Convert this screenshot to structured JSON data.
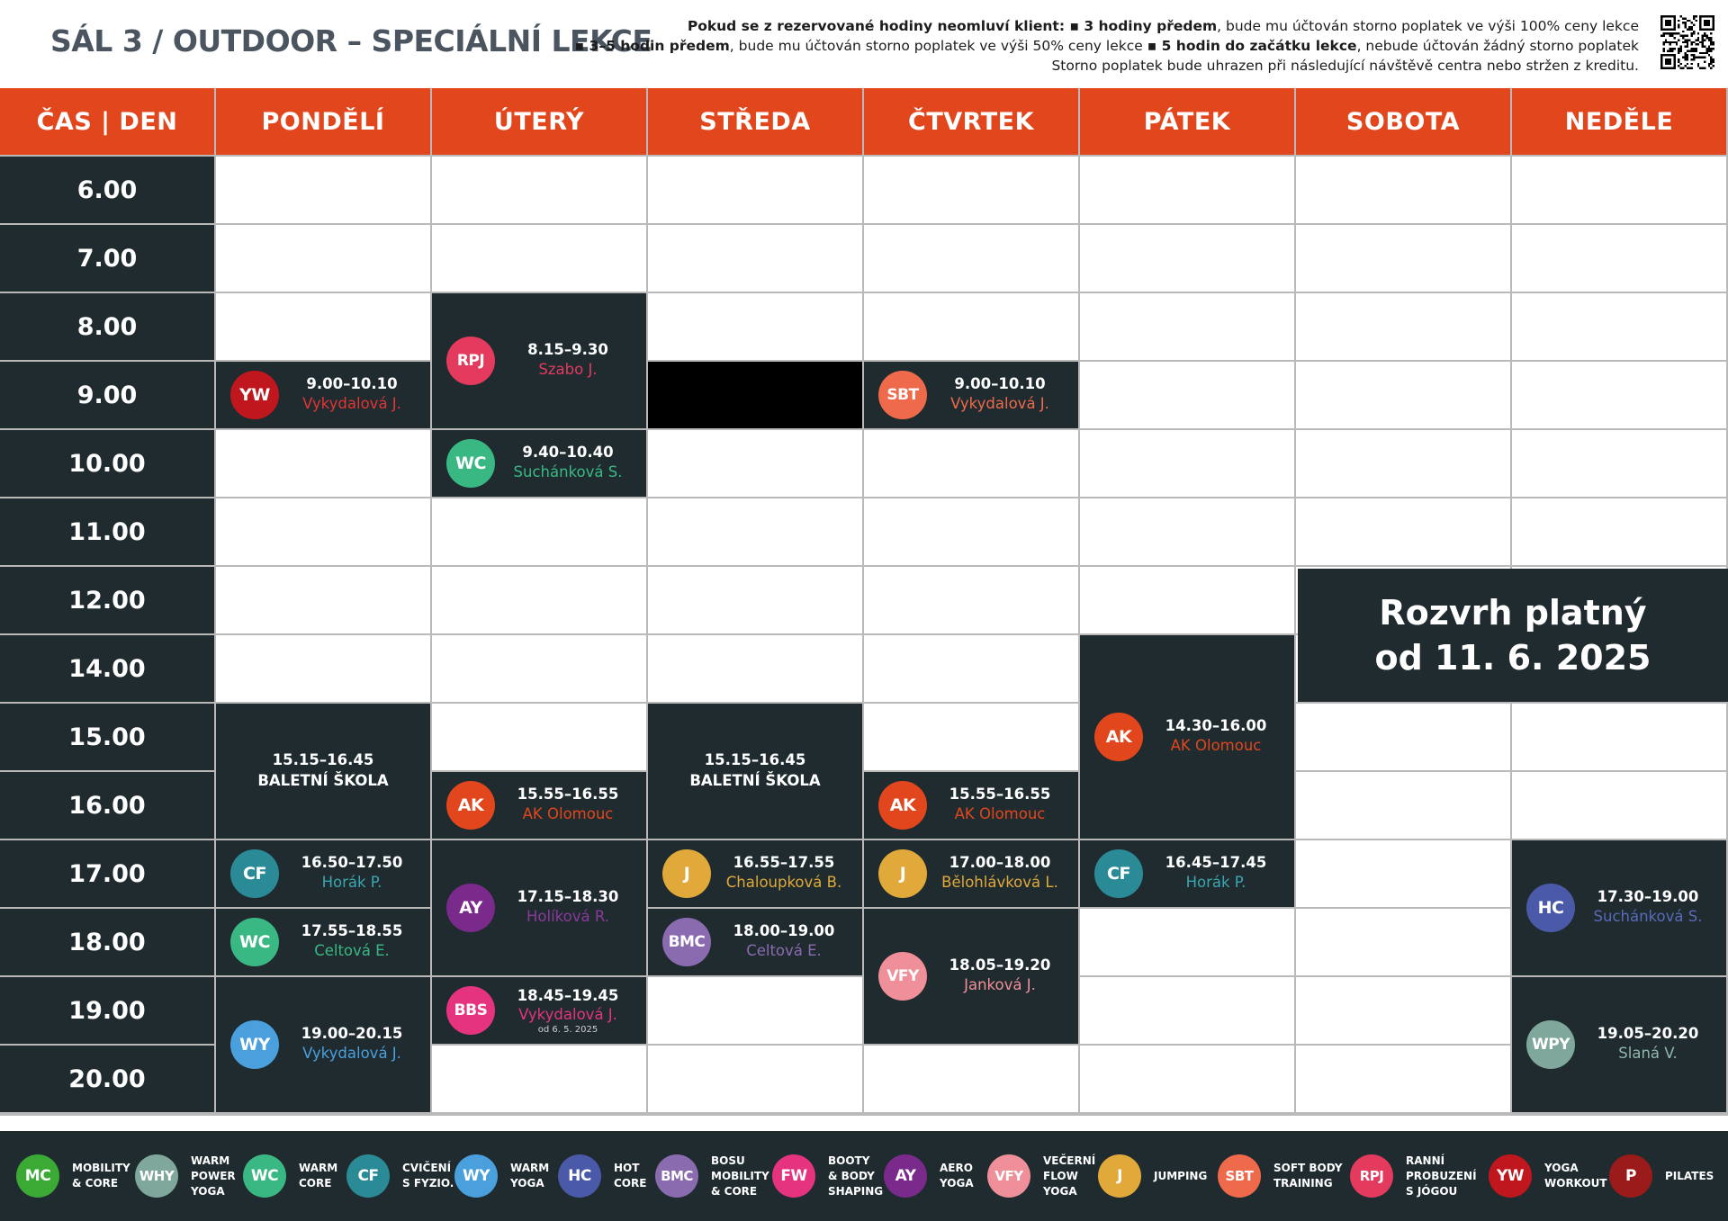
{
  "title": "SÁL  3 / OUTDOOR – SPECIÁLNÍ LEKCE",
  "notice": {
    "line1_plain": "Pokud se z rezervované hodiny neomluví klient: ",
    "line1_b1": "▪ 3 hodiny předem",
    "line1_rest": ", bude mu účtován storno poplatek ve výši 100% ceny lekce",
    "line2_b1": "▪ 3–5 hodin předem",
    "line2_mid": ", bude mu účtován storno poplatek ve výši 50% ceny lekce ",
    "line2_b2": "▪ 5 hodin do začátku lekce",
    "line2_rest": ", nebude účtován žádný storno poplatek",
    "line3": "Storno poplatek bude uhrazen při následující návštěvě centra nebo stržen z kreditu."
  },
  "qr_code": "qr-code-icon",
  "header_corner": "ČAS | DEN",
  "days": [
    "PONDĚLÍ",
    "ÚTERÝ",
    "STŘEDA",
    "ČTVRTEK",
    "PÁTEK",
    "SOBOTA",
    "NEDĚLE"
  ],
  "times": [
    "6.00",
    "7.00",
    "8.00",
    "9.00",
    "10.00",
    "11.00",
    "12.00",
    "14.00",
    "15.00",
    "16.00",
    "17.00",
    "18.00",
    "19.00",
    "20.00"
  ],
  "lessons": [
    {
      "day": 0,
      "row_start": 3,
      "row_span": 1,
      "code": "YW",
      "time": "9.00–10.10",
      "instructor": "Vykydalová J.",
      "color": "#c0161d",
      "text_color": "#e03535"
    },
    {
      "day": 1,
      "row_start": 2,
      "row_span": 2,
      "code": "RPJ",
      "time": "8.15–9.30",
      "instructor": "Szabo J.",
      "color": "#e33a5d",
      "text_color": "#e33a5d"
    },
    {
      "day": 1,
      "row_start": 4,
      "row_span": 1,
      "code": "WC",
      "time": "9.40–10.40",
      "instructor": "Suchánková S.",
      "color": "#3ab883",
      "text_color": "#3ab883"
    },
    {
      "day": 3,
      "row_start": 3,
      "row_span": 1,
      "code": "SBT",
      "time": "9.00–10.10",
      "instructor": "Vykydalová J.",
      "color": "#ef6a4a",
      "text_color": "#ef6a4a"
    },
    {
      "day": 4,
      "row_start": 7,
      "row_span": 3,
      "code": "AK",
      "time": "14.30–16.00",
      "instructor": "AK Olomouc",
      "color": "#e2461c",
      "text_color": "#e2461c"
    },
    {
      "day": 1,
      "row_start": 9,
      "row_span": 1,
      "code": "AK",
      "time": "15.55–16.55",
      "instructor": "AK Olomouc",
      "color": "#e2461c",
      "text_color": "#e2461c"
    },
    {
      "day": 3,
      "row_start": 9,
      "row_span": 1,
      "code": "AK",
      "time": "15.55–16.55",
      "instructor": "AK Olomouc",
      "color": "#e2461c",
      "text_color": "#e2461c"
    },
    {
      "day": 0,
      "row_start": 10,
      "row_span": 1,
      "code": "CF",
      "time": "16.50–17.50",
      "instructor": "Horák P.",
      "color": "#2a8b96",
      "text_color": "#3aa6b0"
    },
    {
      "day": 0,
      "row_start": 11,
      "row_span": 1,
      "code": "WC",
      "time": "17.55–18.55",
      "instructor": "Celtová E.",
      "color": "#3ab883",
      "text_color": "#3ab883"
    },
    {
      "day": 0,
      "row_start": 12,
      "row_span": 2,
      "code": "WY",
      "time": "19.00–20.15",
      "instructor": "Vykydalová J.",
      "color": "#4aa0dc",
      "text_color": "#4aa0dc"
    },
    {
      "day": 1,
      "row_start": 10,
      "row_span": 2,
      "code": "AY",
      "time": "17.15–18.30",
      "instructor": "Holíková R.",
      "color": "#7a2a8a",
      "text_color": "#8a3a9a"
    },
    {
      "day": 1,
      "row_start": 12,
      "row_span": 1,
      "code": "BBS",
      "time": "18.45–19.45",
      "instructor": "Vykydalová J.",
      "color": "#e6337f",
      "text_color": "#e6337f",
      "note": "od 6. 5. 2025"
    },
    {
      "day": 2,
      "row_start": 10,
      "row_span": 1,
      "code": "J",
      "time": "16.55–17.55",
      "instructor": "Chaloupková B.",
      "color": "#e0a93a",
      "text_color": "#e0a93a"
    },
    {
      "day": 2,
      "row_start": 11,
      "row_span": 1,
      "code": "BMC",
      "time": "18.00–19.00",
      "instructor": "Celtová E.",
      "color": "#8b6bb0",
      "text_color": "#8b6bb0"
    },
    {
      "day": 3,
      "row_start": 10,
      "row_span": 1,
      "code": "J",
      "time": "17.00–18.00",
      "instructor": "Bělohlávková L.",
      "color": "#e0a93a",
      "text_color": "#e0a93a"
    },
    {
      "day": 3,
      "row_start": 11,
      "row_span": 2,
      "code": "VFY",
      "time": "18.05–19.20",
      "instructor": "Janková J.",
      "color": "#ef8f99",
      "text_color": "#ef8f99"
    },
    {
      "day": 4,
      "row_start": 10,
      "row_span": 1,
      "code": "CF",
      "time": "16.45–17.45",
      "instructor": "Horák P.",
      "color": "#2a8b96",
      "text_color": "#3aa6b0"
    },
    {
      "day": 6,
      "row_start": 10,
      "row_span": 2,
      "code": "HC",
      "time": "17.30–19.00",
      "instructor": "Suchánková S.",
      "color": "#4a5aa8",
      "text_color": "#5a6ab8"
    },
    {
      "day": 6,
      "row_start": 12,
      "row_span": 2,
      "code": "WPY",
      "time": "19.05–20.20",
      "instructor": "Slaná V.",
      "color": "#7fa79b",
      "text_color": "#8fb7ab"
    }
  ],
  "ballet": [
    {
      "day": 0,
      "row_start": 8,
      "row_span": 2,
      "time": "15.15–16.45",
      "label": "BALETNÍ ŠKOLA"
    },
    {
      "day": 2,
      "row_start": 8,
      "row_span": 2,
      "time": "15.15–16.45",
      "label": "BALETNÍ ŠKOLA"
    }
  ],
  "blackout": {
    "day": 2,
    "row_start": 3,
    "row_span": 1,
    "color": "#000000"
  },
  "validity": {
    "line1": "Rozvrh platný",
    "line2": "od 11. 6. 2025"
  },
  "legend": [
    {
      "code": "MC",
      "label": "MOBILITY\n& CORE",
      "color": "#3aaa35"
    },
    {
      "code": "WHY",
      "label": "WARM\nPOWER\nYOGA",
      "color": "#7fa79b"
    },
    {
      "code": "WC",
      "label": "WARM\nCORE",
      "color": "#3ab883"
    },
    {
      "code": "CF",
      "label": "CVIČENÍ\nS FYZIO.",
      "color": "#2a8b96"
    },
    {
      "code": "WY",
      "label": "WARM\nYOGA",
      "color": "#4aa0dc"
    },
    {
      "code": "HC",
      "label": "HOT\nCORE",
      "color": "#4a5aa8"
    },
    {
      "code": "BMC",
      "label": "BOSU\nMOBILITY\n& CORE",
      "color": "#8b6bb0"
    },
    {
      "code": "FW",
      "label": "BOOTY\n& BODY\nSHAPING",
      "color": "#e6337f"
    },
    {
      "code": "AY",
      "label": "AERO\nYOGA",
      "color": "#7a2a8a"
    },
    {
      "code": "VFY",
      "label": "VEČERNÍ\nFLOW\nYOGA",
      "color": "#ef8f99"
    },
    {
      "code": "J",
      "label": "JUMPING",
      "color": "#e0a93a"
    },
    {
      "code": "SBT",
      "label": "SOFT BODY\nTRAINING",
      "color": "#ef6a4a"
    },
    {
      "code": "RPJ",
      "label": "RANNÍ\nPROBUZENÍ\nS JÓGOU",
      "color": "#e33a5d"
    },
    {
      "code": "YW",
      "label": "YOGA\nWORKOUT",
      "color": "#c0161d"
    },
    {
      "code": "P",
      "label": "PILATES",
      "color": "#9b1b1b"
    }
  ]
}
